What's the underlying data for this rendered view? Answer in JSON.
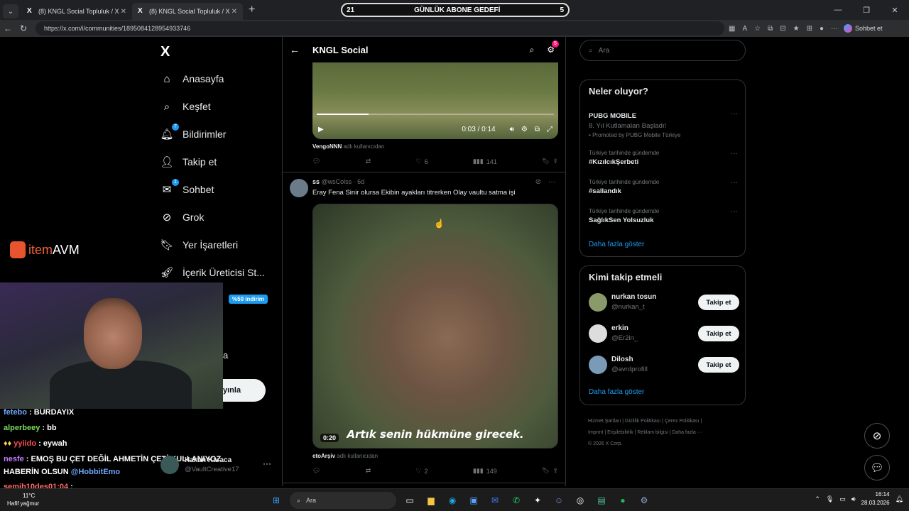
{
  "browser": {
    "tabs": [
      {
        "label": "(8) KNGL Social Topluluk / X",
        "close": "✕"
      },
      {
        "label": "(8) KNGL Social Topluluk / X",
        "close": "✕"
      }
    ],
    "banner": {
      "left": "21",
      "center": "GÜNLÜK ABONE GEDEFİ",
      "right": "5"
    },
    "url": "https://x.com/i/communities/1895084128954933746",
    "copilot_label": "Sohbet et"
  },
  "left_nav": {
    "logo": "X",
    "items": [
      {
        "label": "Anasayfa",
        "icon": "⌂"
      },
      {
        "label": "Keşfet",
        "icon": "⌕"
      },
      {
        "label": "Bildirimler",
        "icon": "🔔︎",
        "badge": "7"
      },
      {
        "label": "Takip et",
        "icon": "👤︎"
      },
      {
        "label": "Sohbet",
        "icon": "✉",
        "badge": "1"
      },
      {
        "label": "Grok",
        "icon": "⊘"
      },
      {
        "label": "Yer İşaretleri",
        "icon": "🔖︎"
      },
      {
        "label": "İçerik Üreticisi St...",
        "icon": "🚀︎"
      }
    ],
    "discount_badge": "%50 indirim",
    "fragment_more": "a",
    "post_button_fragment": "yınla"
  },
  "overlay": {
    "brand_item": "item",
    "brand_avm": "AVM",
    "chat": [
      {
        "user": "fetebo",
        "color": "#6fa8ff",
        "text": " : BURDAYIX"
      },
      {
        "user": "alperbeey",
        "color": "#7ddc5b",
        "text": " : bb"
      },
      {
        "user": "yyiido",
        "color": "#ff4d4d",
        "text": " : eywah"
      },
      {
        "user": "nesfe",
        "color": "#c27dff",
        "text": " : EMOŞ BU ÇET DEĞİL AHMETİN ÇETİ KULLANIYOZ"
      },
      {
        "user": "HABERİN OLSUN",
        "color": "#ffffff",
        "text": " @HobbitEmo"
      },
      {
        "user": "semih10des01:04",
        "color": "#ff6b6b",
        "text": " :"
      }
    ]
  },
  "profile": {
    "name": "Hakan Karaca",
    "handle": "@VaultCreative17",
    "more": "···"
  },
  "feed": {
    "title": "KNGL Social",
    "settings_badge": "5",
    "post1": {
      "time": "0:03 / 0:14",
      "progress": 0.22,
      "credit_user": "VengoNNN",
      "credit_suffix": " adlı kullanıcıdan",
      "likes": "6",
      "views": "141"
    },
    "post2": {
      "name": "ss",
      "handle": "@wsColss · 6d",
      "text": "Eray Fena Sinir olursa Ekibin ayakları titrerken Olay vaultu satma işi",
      "subtitle": "Artık senin hükmüne girecek.",
      "duration": "0:20",
      "credit_user": "etoArşiv",
      "credit_suffix": " adlı kullanıcıdan",
      "likes": "2",
      "views": "149"
    }
  },
  "right": {
    "search_placeholder": "Ara",
    "trends_title": "Neler oluyor?",
    "trends": [
      {
        "cat": "",
        "name": "PUBG MOBILE",
        "sub": "8. Yıl Kutlamaları Başladı!",
        "promo": "Promoted by PUBG Mobile Türkiye"
      },
      {
        "cat": "Türkiye tarihinde gündemde",
        "name": "#KızılcıkŞerbeti",
        "sub": "",
        "promo": ""
      },
      {
        "cat": "Türkiye tarihinde gündemde",
        "name": "#sallandık",
        "sub": "",
        "promo": ""
      },
      {
        "cat": "Türkiye tarihinde gündemde",
        "name": "SağlıkSen Yolsuzluk",
        "sub": "",
        "promo": ""
      }
    ],
    "show_more": "Daha fazla göster",
    "who_title": "Kimi takip etmeli",
    "who": [
      {
        "name": "nurkan tosun",
        "handle": "@nurkan_t",
        "btn": "Takip et"
      },
      {
        "name": "erkin",
        "handle": "@Er2in_",
        "btn": "Takip et"
      },
      {
        "name": "Dilosh",
        "handle": "@avrdprofill",
        "btn": "Takip et"
      }
    ],
    "who_more": "Daha fazla göster",
    "footer_line1": "Hizmet Şartları  |  Gizlilik Politikası  |  Çerez Politikası  |",
    "footer_line2": "Imprint  |  Erişilebilirlik  |  Reklam bilgisi  |  Daha fazla ···",
    "footer_line3": "© 2026 X Corp."
  },
  "taskbar": {
    "temp": "11°C",
    "weather": "Hafif yağmur",
    "search": "Ara",
    "time": "16:14",
    "date": "28.03.2026"
  }
}
